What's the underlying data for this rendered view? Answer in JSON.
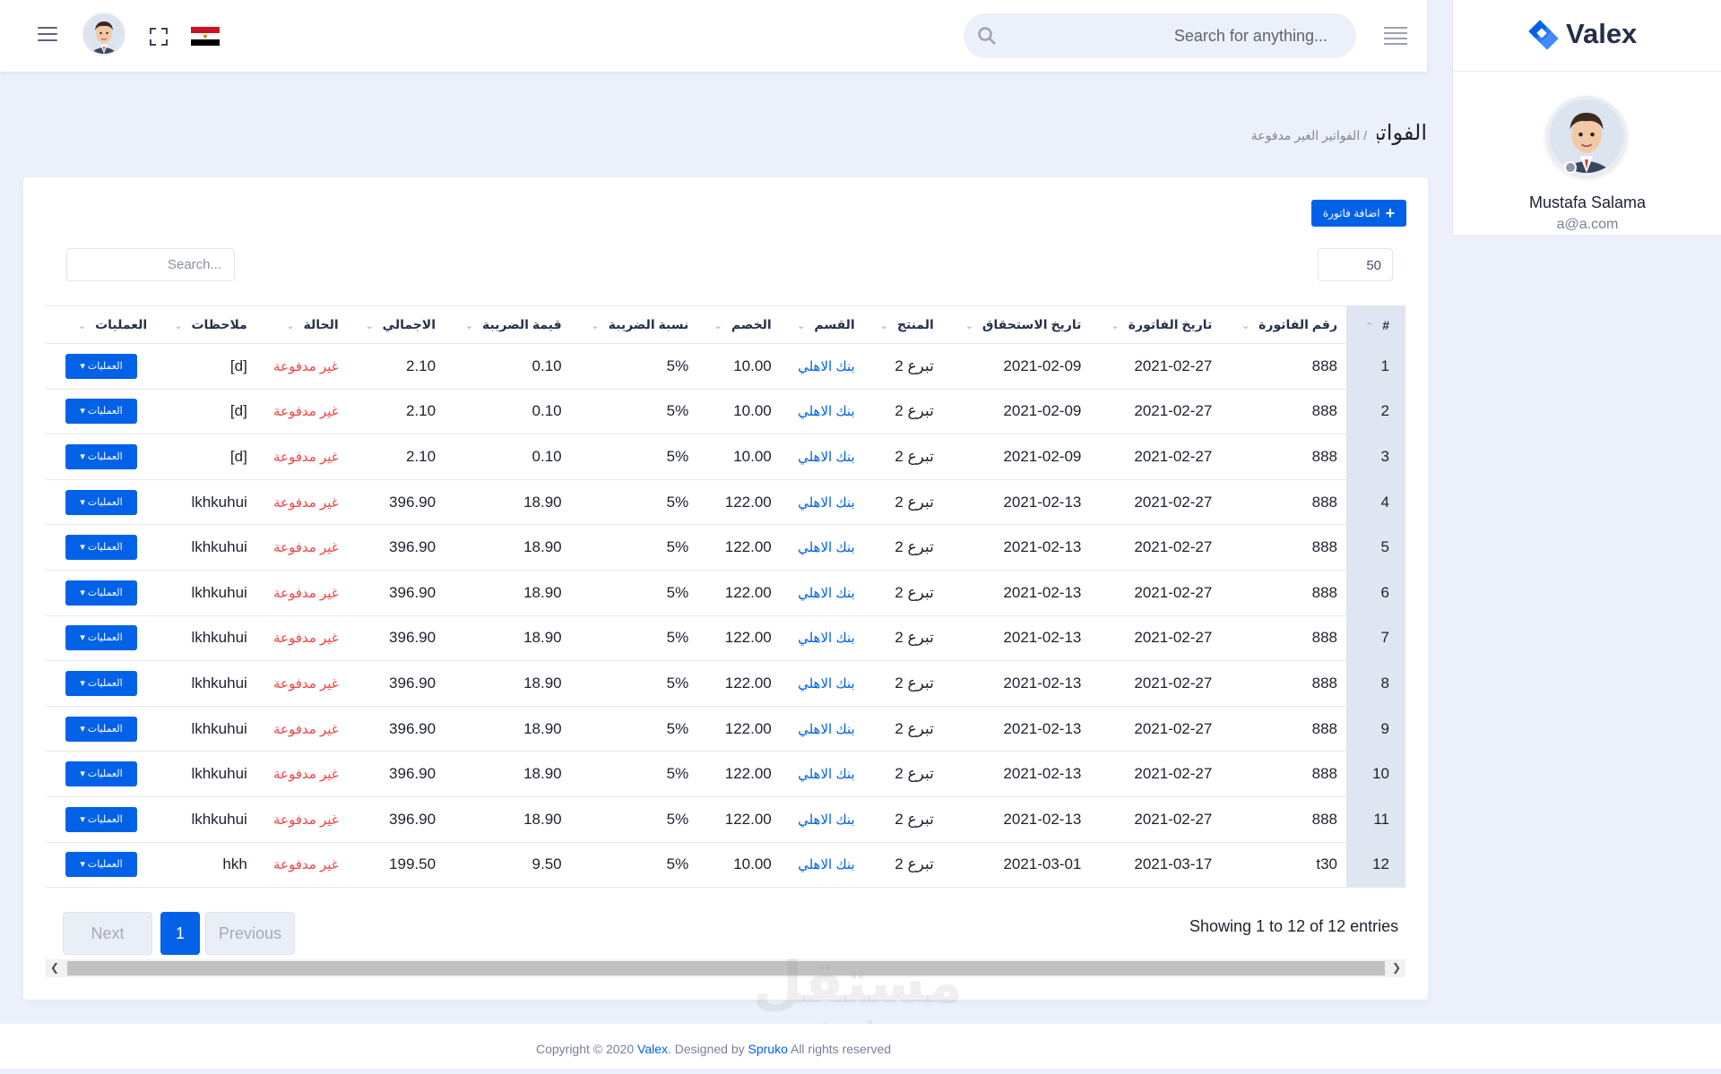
{
  "header": {
    "search_placeholder": "Search for anything...",
    "icons": [
      "menu-icon",
      "avatar",
      "fullscreen-icon",
      "egypt-flag-icon",
      "search-icon",
      "menu-lines-icon"
    ],
    "flag_colors": [
      "#ce1126",
      "#ffffff",
      "#000000"
    ]
  },
  "sidebar": {
    "logo_text": "Valex",
    "user_name": "Mustafa Salama",
    "user_email": "a@a.com"
  },
  "breadcrumb": {
    "title": "الفواتير",
    "separator": "/",
    "sub": "الفواتير الغير مدفوعة"
  },
  "toolbar": {
    "add_label": "اضافة فاتورة",
    "page_length": "50",
    "search_placeholder": "Search..."
  },
  "table": {
    "columns": [
      "#",
      "رقم الفاتورة",
      "تاريخ الفاتورة",
      "تاريخ الاستحقاق",
      "المنتج",
      "القسم",
      "الخصم",
      "نسبة الضريبة",
      "قيمة الضريبة",
      "الاجمالي",
      "الحالة",
      "ملاحظات",
      "العمليات"
    ],
    "op_label": "العمليات",
    "rows": [
      [
        "1",
        "888",
        "2021-02-27",
        "2021-02-09",
        "تبرع 2",
        "بنك الاهلي",
        "10.00",
        "5%",
        "0.10",
        "2.10",
        "غير مدفوعة",
        "[d]"
      ],
      [
        "2",
        "888",
        "2021-02-27",
        "2021-02-09",
        "تبرع 2",
        "بنك الاهلي",
        "10.00",
        "5%",
        "0.10",
        "2.10",
        "غير مدفوعة",
        "[d]"
      ],
      [
        "3",
        "888",
        "2021-02-27",
        "2021-02-09",
        "تبرع 2",
        "بنك الاهلي",
        "10.00",
        "5%",
        "0.10",
        "2.10",
        "غير مدفوعة",
        "[d]"
      ],
      [
        "4",
        "888",
        "2021-02-27",
        "2021-02-13",
        "تبرع 2",
        "بنك الاهلي",
        "122.00",
        "5%",
        "18.90",
        "396.90",
        "غير مدفوعة",
        "lkhkuhui"
      ],
      [
        "5",
        "888",
        "2021-02-27",
        "2021-02-13",
        "تبرع 2",
        "بنك الاهلي",
        "122.00",
        "5%",
        "18.90",
        "396.90",
        "غير مدفوعة",
        "lkhkuhui"
      ],
      [
        "6",
        "888",
        "2021-02-27",
        "2021-02-13",
        "تبرع 2",
        "بنك الاهلي",
        "122.00",
        "5%",
        "18.90",
        "396.90",
        "غير مدفوعة",
        "lkhkuhui"
      ],
      [
        "7",
        "888",
        "2021-02-27",
        "2021-02-13",
        "تبرع 2",
        "بنك الاهلي",
        "122.00",
        "5%",
        "18.90",
        "396.90",
        "غير مدفوعة",
        "lkhkuhui"
      ],
      [
        "8",
        "888",
        "2021-02-27",
        "2021-02-13",
        "تبرع 2",
        "بنك الاهلي",
        "122.00",
        "5%",
        "18.90",
        "396.90",
        "غير مدفوعة",
        "lkhkuhui"
      ],
      [
        "9",
        "888",
        "2021-02-27",
        "2021-02-13",
        "تبرع 2",
        "بنك الاهلي",
        "122.00",
        "5%",
        "18.90",
        "396.90",
        "غير مدفوعة",
        "lkhkuhui"
      ],
      [
        "10",
        "888",
        "2021-02-27",
        "2021-02-13",
        "تبرع 2",
        "بنك الاهلي",
        "122.00",
        "5%",
        "18.90",
        "396.90",
        "غير مدفوعة",
        "lkhkuhui"
      ],
      [
        "11",
        "888",
        "2021-02-27",
        "2021-02-13",
        "تبرع 2",
        "بنك الاهلي",
        "122.00",
        "5%",
        "18.90",
        "396.90",
        "غير مدفوعة",
        "lkhkuhui"
      ],
      [
        "12",
        "t30",
        "2021-03-17",
        "2021-03-01",
        "تبرع 2",
        "بنك الاهلي",
        "10.00",
        "5%",
        "9.50",
        "199.50",
        "غير مدفوعة",
        "hkh"
      ]
    ]
  },
  "pagination": {
    "info": "Showing 1 to 12 of 12 entries",
    "next": "Next",
    "current": "1",
    "previous": "Previous"
  },
  "footer": {
    "prefix": "Copyright © 2020",
    "brand": "Valex",
    "mid": ". Designed by",
    "designer": "Spruko",
    "suffix": "All rights reserved"
  },
  "watermark": {
    "ar": "مستقل",
    "en": "mostaql.com"
  },
  "colors": {
    "primary": "#0162e8",
    "danger": "#f34343",
    "background": "#ecf0fa"
  }
}
